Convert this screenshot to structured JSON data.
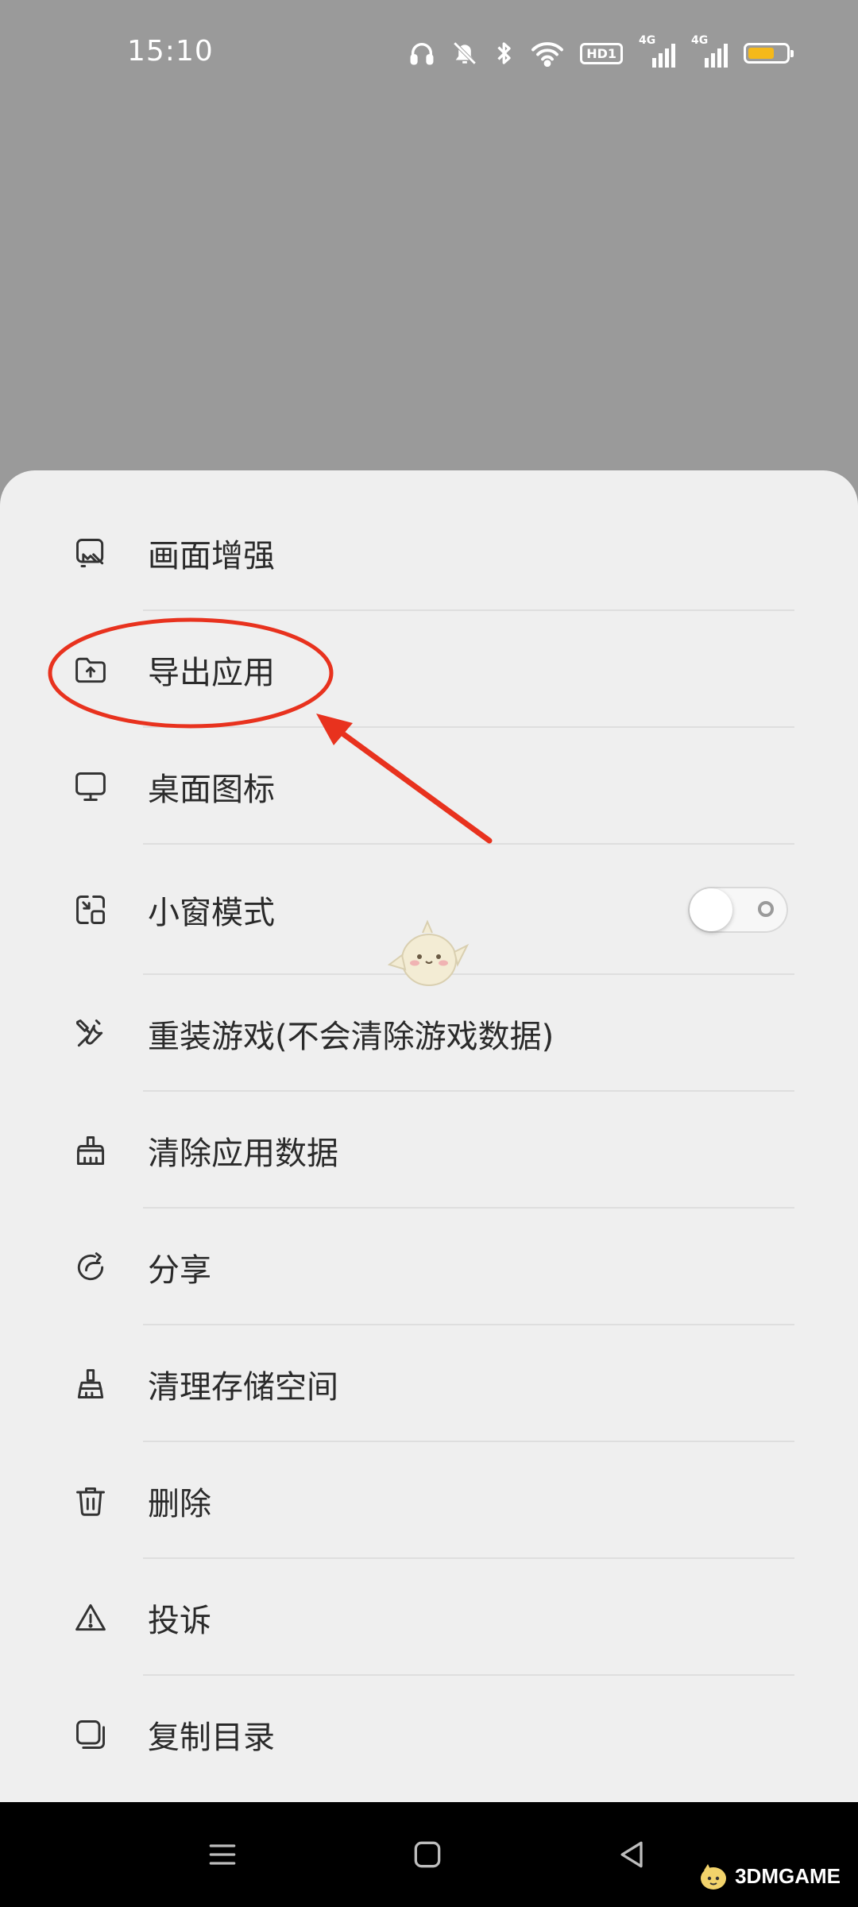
{
  "status_bar": {
    "time": "15:10",
    "icons": [
      "headphones-icon",
      "bell-off-icon",
      "bluetooth-icon",
      "wifi-icon",
      "hd-icon",
      "signal-4g-icon",
      "signal-4g-icon",
      "battery-icon"
    ],
    "hd_label": "HD1",
    "network_label_1": "4G",
    "network_label_2": "4G",
    "battery_level": 0.7
  },
  "menu": {
    "items": [
      {
        "label": "画面增强",
        "icon": "image-enhance-icon"
      },
      {
        "label": "导出应用",
        "icon": "folder-upload-icon"
      },
      {
        "label": "桌面图标",
        "icon": "monitor-icon"
      },
      {
        "label": "小窗模式",
        "icon": "small-window-icon",
        "toggle": false
      },
      {
        "label": "重装游戏(不会清除游戏数据)",
        "icon": "tools-icon"
      },
      {
        "label": "清除应用数据",
        "icon": "broom-icon"
      },
      {
        "label": "分享",
        "icon": "share-icon"
      },
      {
        "label": "清理存储空间",
        "icon": "brush-icon"
      },
      {
        "label": "删除",
        "icon": "trash-icon"
      },
      {
        "label": "投诉",
        "icon": "warning-icon"
      },
      {
        "label": "复制目录",
        "icon": "copy-icon"
      }
    ]
  },
  "annotation": {
    "color": "#e8321e",
    "highlighted_item": "导出应用"
  },
  "nav_bar": {
    "buttons": [
      "menu-icon",
      "home-icon",
      "back-icon"
    ]
  },
  "watermark": {
    "text": "3DMGAME"
  },
  "colors": {
    "overlay": "#9a9a9a",
    "sheet": "#efefef",
    "battery": "#f5b91a",
    "navbar": "#000000"
  }
}
